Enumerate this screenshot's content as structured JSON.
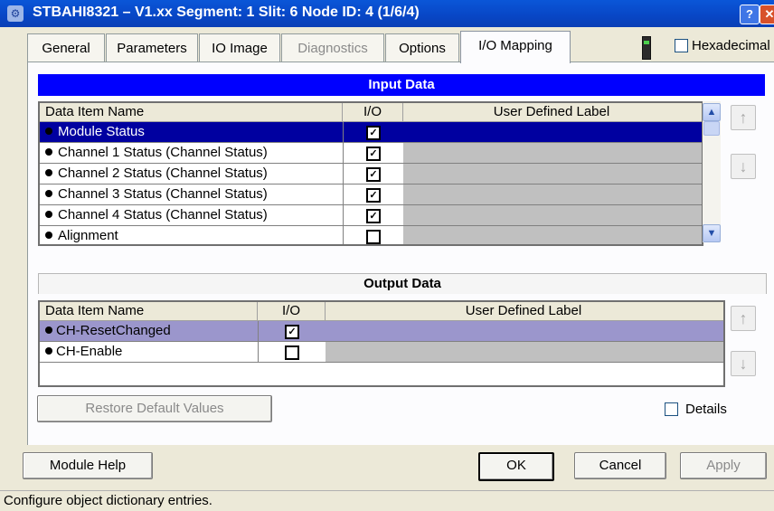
{
  "window": {
    "title": "STBAHI8321 – V1.xx Segment: 1 Slit: 6 Node ID: 4 (1/6/4)",
    "help_label": "?",
    "close_label": "✕"
  },
  "tabs": [
    {
      "label": "General"
    },
    {
      "label": "Parameters"
    },
    {
      "label": "IO Image"
    },
    {
      "label": "Diagnostics"
    },
    {
      "label": "Options"
    },
    {
      "label": "I/O Mapping"
    }
  ],
  "hexadecimal": {
    "label": "Hexadecimal",
    "checked": false
  },
  "input_data": {
    "title": "Input Data",
    "columns": {
      "name": "Data Item Name",
      "io": "I/O",
      "label": "User Defined Label"
    },
    "rows": [
      {
        "name": "Module Status",
        "checked": true,
        "selected": true
      },
      {
        "name": "Channel 1 Status (Channel Status)",
        "checked": true
      },
      {
        "name": "Channel 2 Status (Channel Status)",
        "checked": true
      },
      {
        "name": "Channel 3 Status (Channel Status)",
        "checked": true
      },
      {
        "name": "Channel 4 Status (Channel Status)",
        "checked": true
      },
      {
        "name": "Alignment",
        "checked": false
      }
    ]
  },
  "output_data": {
    "title": "Output Data",
    "columns": {
      "name": "Data Item Name",
      "io": "I/O",
      "label": "User Defined Label"
    },
    "rows": [
      {
        "name": "CH-ResetChanged",
        "checked": true,
        "selected": true
      },
      {
        "name": "CH-Enable",
        "checked": false
      }
    ]
  },
  "buttons": {
    "restore": "Restore Default Values",
    "details": "Details",
    "module_help": "Module Help",
    "ok": "OK",
    "cancel": "Cancel",
    "apply": "Apply"
  },
  "status_bar": "Configure object dictionary entries.",
  "icons": {
    "up": "up-arrow-icon",
    "down": "down-arrow-icon",
    "check": "checkmark-icon"
  },
  "colors": {
    "title_bar": "#0a56d8",
    "input_header": "#0000ff",
    "selected_row": "#0000a0",
    "selected_output_row": "#9b96cc"
  }
}
